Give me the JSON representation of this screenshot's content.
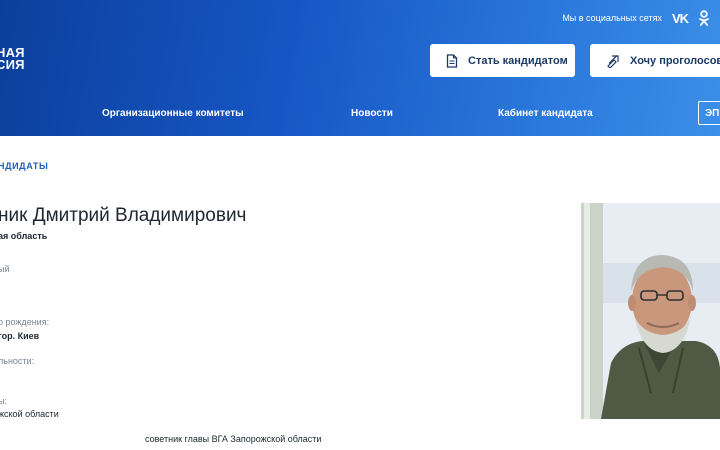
{
  "header": {
    "logo_line1": "ная",
    "logo_line2": "сия",
    "social_text": "Мы в социальных сетях",
    "social_vk": "VK",
    "buttons": {
      "candidate_label": "Стать кандидатом",
      "vote_label": "Хочу проголосовать"
    },
    "nav": [
      {
        "label": "Организационные комитеты"
      },
      {
        "label": "Новости"
      },
      {
        "label": "Кабинет кандидата"
      }
    ],
    "nav_box_label": "ЭП"
  },
  "breadcrumb": "ндидаты",
  "candidate": {
    "name": "ник Дмитрий Владимирович",
    "region": "ая область",
    "field1_label": "ый",
    "birthplace_label": "о рождения:",
    "birthplace_value": "гор. Киев",
    "occupation_label": "льности:",
    "work_label": "ы:",
    "work_value": "жской области",
    "position_value": "советник главы ВГА Запорожской области"
  },
  "colors": {
    "header_start": "#0c3f9c",
    "header_end": "#3c8fe8",
    "link_blue": "#1b5fb8",
    "button_text": "#1b3a66"
  },
  "icons": {
    "vk": "vk-icon",
    "ok": "odnoklassniki-icon",
    "candidate": "document-icon",
    "vote": "ballot-icon"
  }
}
